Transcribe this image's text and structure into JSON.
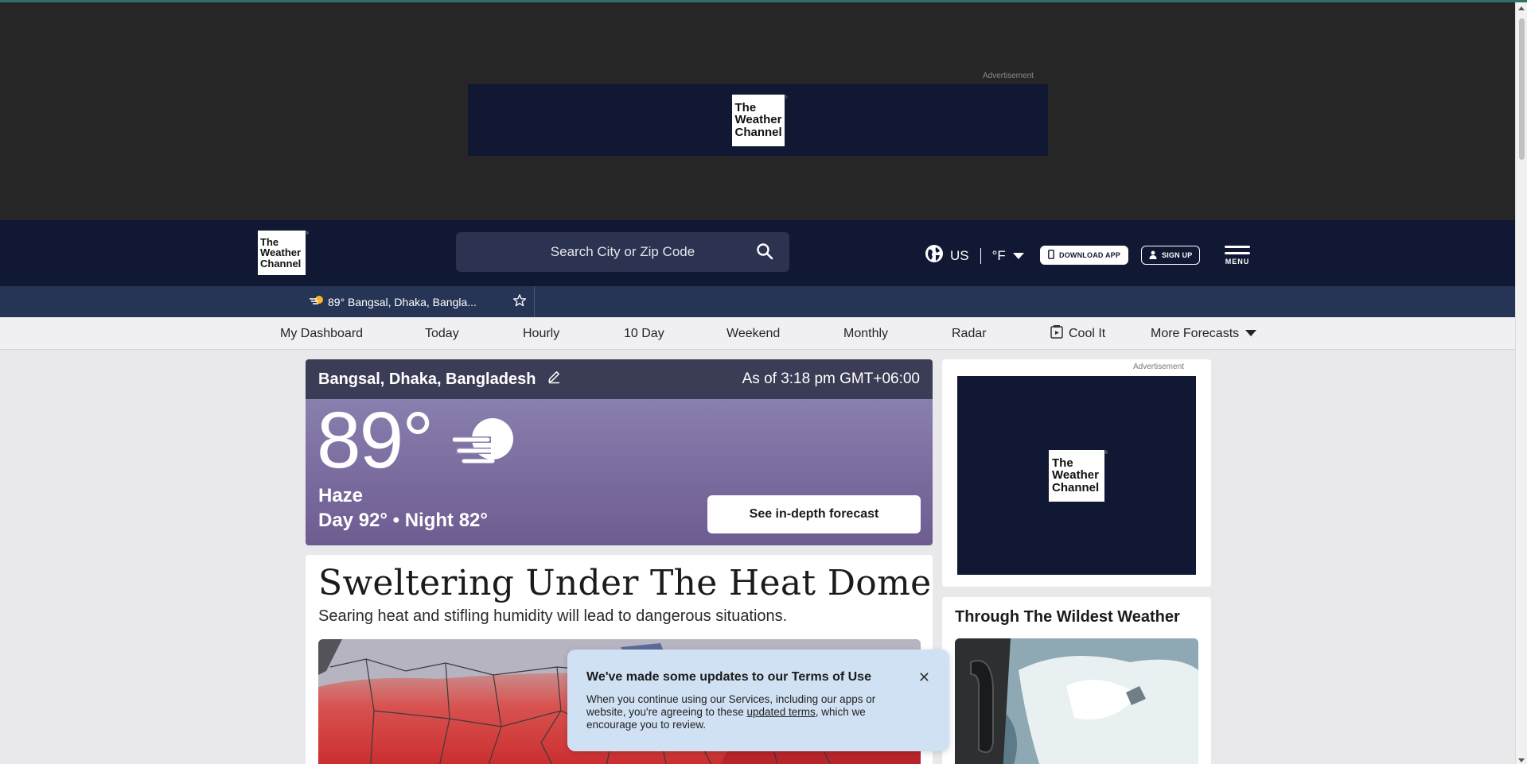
{
  "top_ad": {
    "label": "Advertisement",
    "logo_lines": [
      "The",
      "Weather",
      "Channel"
    ]
  },
  "header": {
    "logo_lines": [
      "The",
      "Weather",
      "Channel"
    ],
    "search_placeholder": "Search City or Zip Code",
    "region": "US",
    "unit": "°F",
    "download_label": "DOWNLOAD APP",
    "signup_label": "SIGN UP",
    "menu_label": "MENU"
  },
  "recent": {
    "label": "89° Bangsal, Dhaka, Bangla..."
  },
  "nav": {
    "items": [
      "My Dashboard",
      "Today",
      "Hourly",
      "10 Day",
      "Weekend",
      "Monthly",
      "Radar",
      "Cool It",
      "More Forecasts"
    ]
  },
  "current": {
    "location": "Bangsal, Dhaka, Bangladesh",
    "as_of": "As of 3:18 pm GMT+06:00",
    "temp": "89°",
    "phrase": "Haze",
    "day_night": "Day 92° • Night 82°",
    "button": "See in-depth forecast",
    "icon": "haze-sun-icon"
  },
  "story": {
    "title": "Sweltering Under The Heat Dome",
    "subtitle": "Searing heat and stifling humidity will lead to dangerous situations."
  },
  "side_ad": {
    "label": "Advertisement",
    "logo_lines": [
      "The",
      "Weather",
      "Channel"
    ]
  },
  "video": {
    "title": "Through The Wildest Weather"
  },
  "terms": {
    "title": "We've made some updates to our Terms of Use",
    "body_before": "When you continue using our Services, including our apps or website, you're agreeing to these ",
    "link": "updated terms",
    "body_after": ", which we encourage you to review."
  },
  "colors": {
    "header_bg": "#111833",
    "recent_bg": "#263455",
    "cc_purple": "#7a6b9e",
    "toast_bg": "#cfe1f3"
  }
}
